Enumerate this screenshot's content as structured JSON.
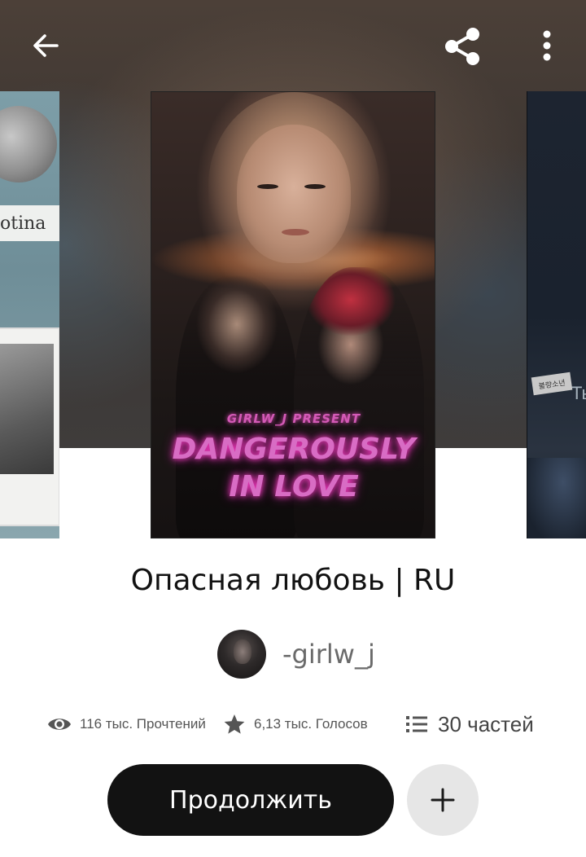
{
  "topbar": {
    "back_icon": "arrow-left-icon",
    "share_icon": "share-icon",
    "more_icon": "more-vertical-icon"
  },
  "carousel": {
    "left_cover": {
      "visible_text": "otina"
    },
    "main_cover": {
      "subtitle": "GIRLW_J PRESENT",
      "title_line1": "DANGEROUSLY",
      "title_line2": "IN LOVE"
    },
    "right_cover": {
      "visible_text": "Ты",
      "sticker_text": "불량소년"
    }
  },
  "story": {
    "title": "Опасная любовь | RU",
    "author": "-girlw_j"
  },
  "stats": {
    "reads": "116 тыс. Прочтений",
    "votes": "6,13 тыс. Голосов",
    "parts": "30 частей",
    "reads_icon": "eye-icon",
    "votes_icon": "star-icon",
    "parts_icon": "list-icon"
  },
  "actions": {
    "continue_label": "Продолжить",
    "add_icon": "plus-icon"
  },
  "colors": {
    "primary_button": "#121212",
    "secondary_button": "#e6e6e6",
    "title_text": "#121212",
    "muted_text": "#6a6a6a",
    "cover_neon": "#d86cc4"
  }
}
